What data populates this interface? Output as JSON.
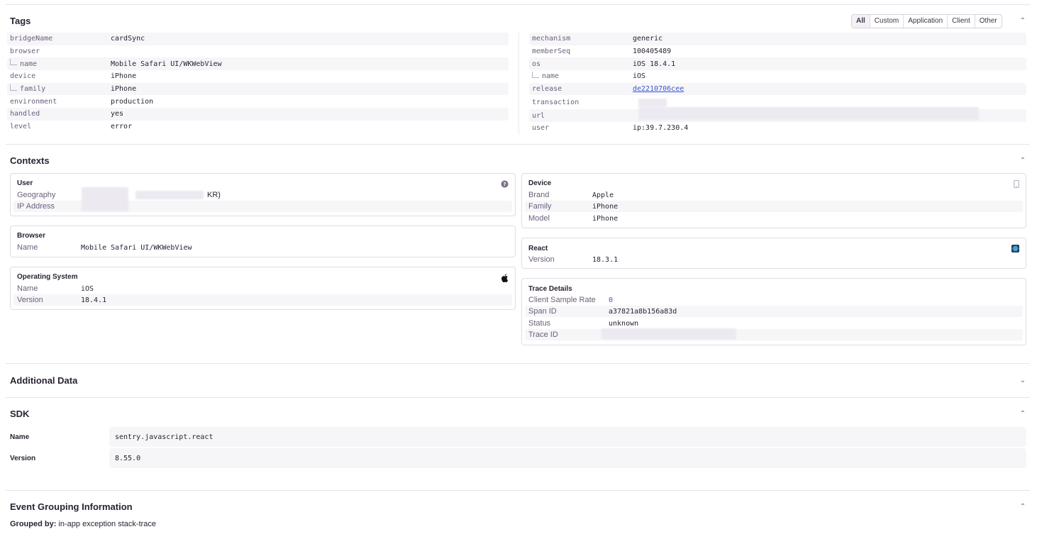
{
  "tags": {
    "title": "Tags",
    "filters": [
      "All",
      "Custom",
      "Application",
      "Client",
      "Other"
    ],
    "active_filter": "All",
    "left": [
      {
        "key": "bridgeName",
        "value": "cardSync",
        "child": false
      },
      {
        "key": "browser",
        "value": "",
        "child": false
      },
      {
        "key": "name",
        "value": "Mobile Safari UI/WKWebView",
        "child": true
      },
      {
        "key": "device",
        "value": "iPhone",
        "child": false
      },
      {
        "key": "family",
        "value": "iPhone",
        "child": true
      },
      {
        "key": "environment",
        "value": "production",
        "child": false
      },
      {
        "key": "handled",
        "value": "yes",
        "child": false
      },
      {
        "key": "level",
        "value": "error",
        "child": false
      }
    ],
    "right": [
      {
        "key": "mechanism",
        "value": "generic",
        "child": false
      },
      {
        "key": "memberSeq",
        "value": "100405489",
        "child": false
      },
      {
        "key": "os",
        "value": "iOS 18.4.1",
        "child": false
      },
      {
        "key": "name",
        "value": "iOS",
        "child": true
      },
      {
        "key": "release",
        "value": "de2210706cee",
        "child": false,
        "link": true
      },
      {
        "key": "transaction",
        "value": "",
        "child": false
      },
      {
        "key": "url",
        "value": "",
        "child": false
      },
      {
        "key": "user",
        "value": "ip:39.7.230.4",
        "child": false
      }
    ]
  },
  "contexts": {
    "title": "Contexts",
    "user": {
      "title": "User",
      "geo_key": "Geography",
      "geo_suffix": "KR)",
      "ip_key": "IP Address"
    },
    "browser": {
      "title": "Browser",
      "name_key": "Name",
      "name_val": "Mobile Safari UI/WKWebView"
    },
    "os": {
      "title": "Operating System",
      "name_key": "Name",
      "name_val": "iOS",
      "ver_key": "Version",
      "ver_val": "18.4.1"
    },
    "device": {
      "title": "Device",
      "brand_key": "Brand",
      "brand_val": "Apple",
      "family_key": "Family",
      "family_val": "iPhone",
      "model_key": "Model",
      "model_val": "iPhone"
    },
    "react": {
      "title": "React",
      "ver_key": "Version",
      "ver_val": "18.3.1"
    },
    "trace": {
      "title": "Trace Details",
      "rate_key": "Client Sample Rate",
      "rate_val": "0",
      "span_key": "Span ID",
      "span_val": "a37821a8b156a83d",
      "status_key": "Status",
      "status_val": "unknown",
      "trace_key": "Trace ID"
    }
  },
  "additional": {
    "title": "Additional Data"
  },
  "sdk": {
    "title": "SDK",
    "name_key": "Name",
    "name_val": "sentry.javascript.react",
    "ver_key": "Version",
    "ver_val": "8.55.0"
  },
  "grouping": {
    "title": "Event Grouping Information",
    "label": "Grouped by:",
    "value": "in-app exception stack-trace"
  },
  "colors": {
    "link": "#3c59c9",
    "accent_icon": "#1d3b5e",
    "shade": "#f6f5f8"
  }
}
